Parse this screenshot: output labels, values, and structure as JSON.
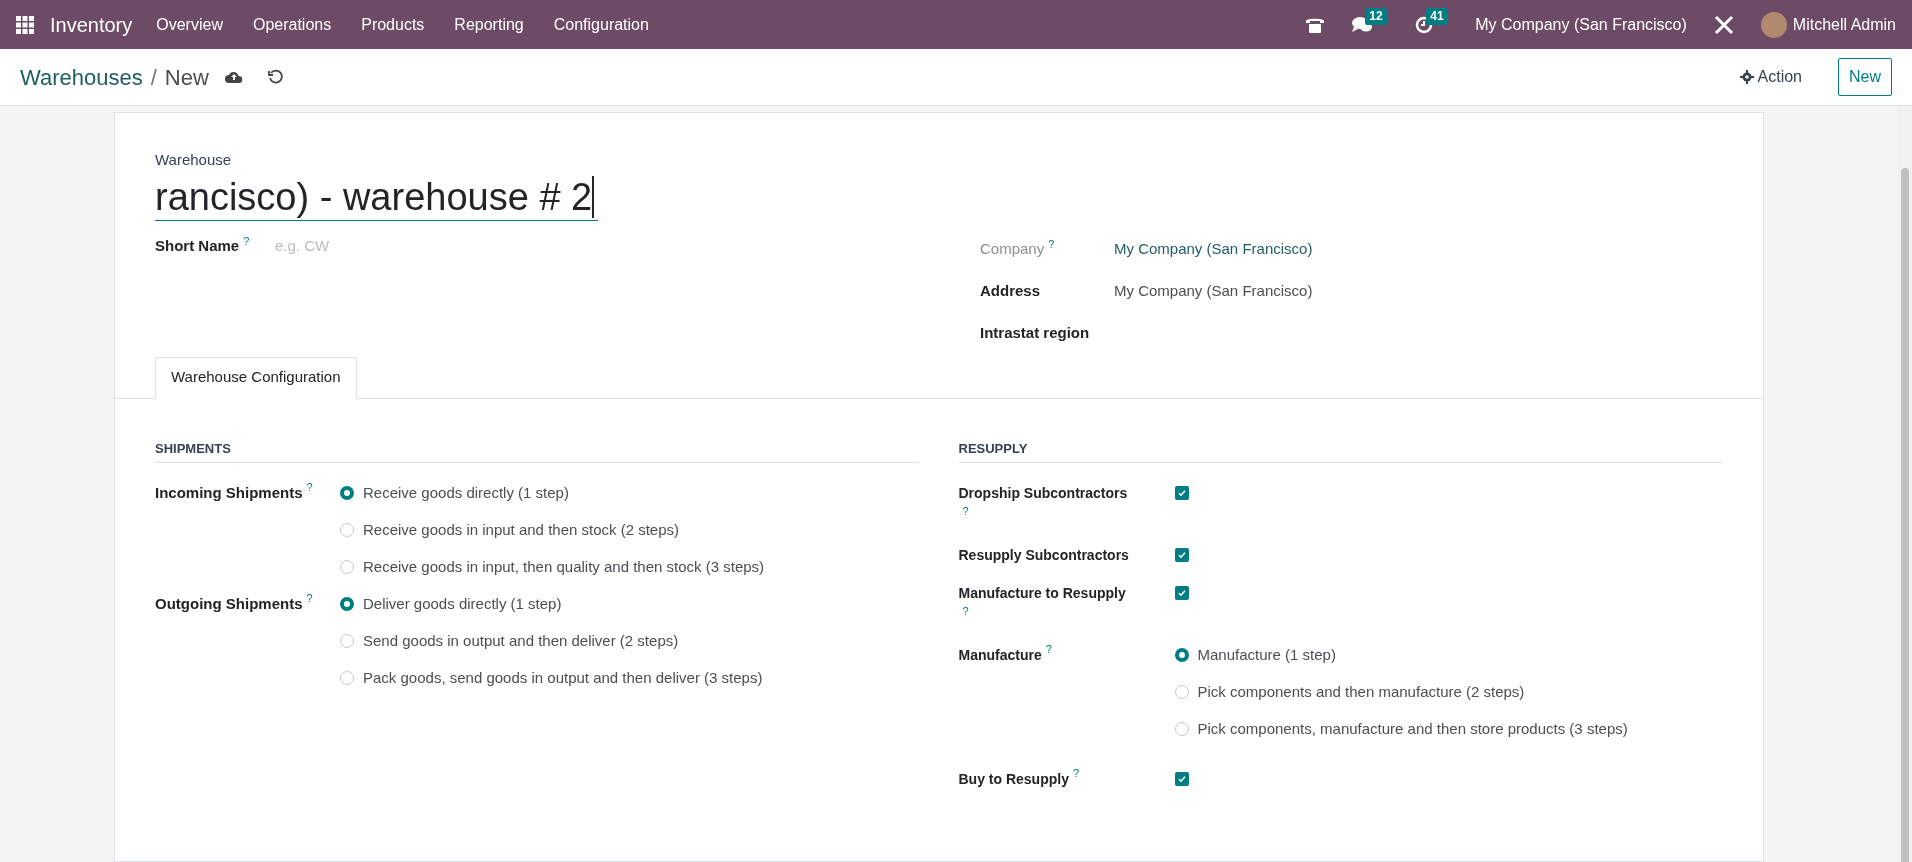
{
  "navbar": {
    "app": "Inventory",
    "menu": [
      "Overview",
      "Operations",
      "Products",
      "Reporting",
      "Configuration"
    ],
    "messages_count": "12",
    "activities_count": "41",
    "company": "My Company (San Francisco)",
    "user": "Mitchell Admin"
  },
  "control_panel": {
    "breadcrumb": "Warehouses",
    "separator": "/",
    "current": "New",
    "action": "Action",
    "new_button": "New"
  },
  "form": {
    "name_label": "Warehouse",
    "name_value": "rancisco) - warehouse # 2",
    "left_fields": [
      {
        "label": "Short Name",
        "help": "?",
        "placeholder": "e.g. CW"
      }
    ],
    "right_fields": [
      {
        "label": "Company",
        "help": "?",
        "value": "My Company (San Francisco)",
        "muted_label": true,
        "link": true
      },
      {
        "label": "Address",
        "value": "My Company (San Francisco)",
        "muted_label": false,
        "link": false
      },
      {
        "label": "Intrastat region",
        "muted_label": false
      }
    ],
    "tabs": [
      {
        "label": "Warehouse Configuration",
        "selected": true
      }
    ],
    "shipments": {
      "title": "SHIPMENTS",
      "groups": [
        {
          "label": "Incoming Shipments",
          "help": "?",
          "options": [
            {
              "label": "Receive goods directly (1 step)",
              "selected": true
            },
            {
              "label": "Receive goods in input and then stock (2 steps)",
              "selected": false
            },
            {
              "label": "Receive goods in input, then quality and then stock (3 steps)",
              "selected": false
            }
          ]
        },
        {
          "label": "Outgoing Shipments",
          "help": "?",
          "options": [
            {
              "label": "Deliver goods directly (1 step)",
              "selected": true
            },
            {
              "label": "Send goods in output and then deliver (2 steps)",
              "selected": false
            },
            {
              "label": "Pack goods, send goods in output and then deliver (3 steps)",
              "selected": false
            }
          ]
        }
      ]
    },
    "resupply": {
      "title": "RESUPPLY",
      "items": [
        {
          "kind": "checkbox",
          "label": "Dropship Subcontractors",
          "help": "?",
          "checked": true
        },
        {
          "kind": "checkbox",
          "label": "Resupply Subcontractors",
          "checked": true
        },
        {
          "kind": "checkbox",
          "label": "Manufacture to Resupply",
          "help": "?",
          "checked": true
        },
        {
          "kind": "radio",
          "label": "Manufacture",
          "help": "?",
          "options": [
            {
              "label": "Manufacture (1 step)",
              "selected": true
            },
            {
              "label": "Pick components and then manufacture (2 steps)",
              "selected": false
            },
            {
              "label": "Pick components, manufacture and then store products (3 steps)",
              "selected": false
            }
          ]
        },
        {
          "kind": "checkbox",
          "label": "Buy to Resupply",
          "help": "?",
          "checked": true
        }
      ]
    }
  }
}
